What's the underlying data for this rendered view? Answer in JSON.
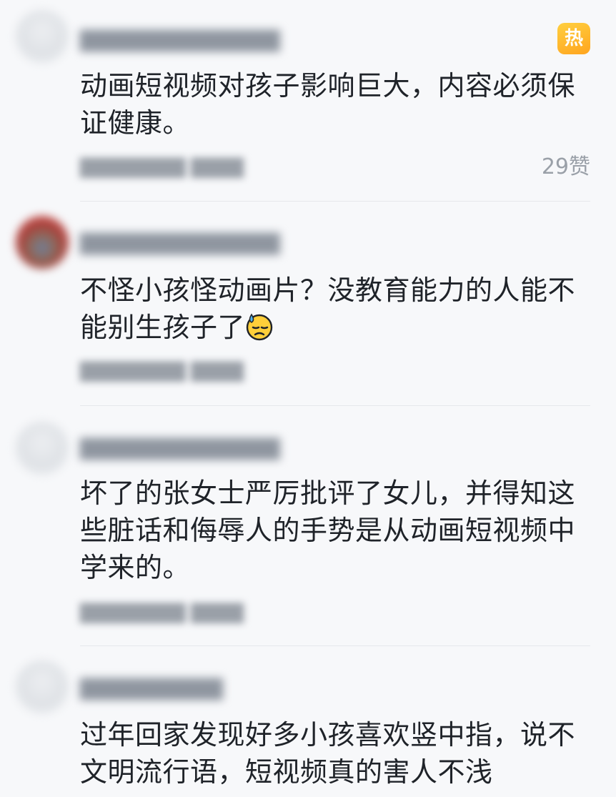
{
  "hot_badge": "热",
  "comments": [
    {
      "username": "██████████████",
      "content": "动画短视频对孩子影响巨大，内容必须保证健康。",
      "meta": "████████  ████",
      "likes": "29赞"
    },
    {
      "username": "██████████████",
      "content": "不怪小孩怪动画片？没教育能力的人能不能别生孩子了",
      "emoji": "downcast-face-with-sweat-icon",
      "meta": "████████  ████"
    },
    {
      "username": "██████████████",
      "content": "坏了的张女士严厉批评了女儿，并得知这些脏话和侮辱人的手势是从动画短视频中学来的。",
      "meta": "████████  ████"
    },
    {
      "username": "██████████",
      "content": "过年回家发现好多小孩喜欢竖中指，说不文明流行语，短视频真的害人不浅"
    }
  ]
}
